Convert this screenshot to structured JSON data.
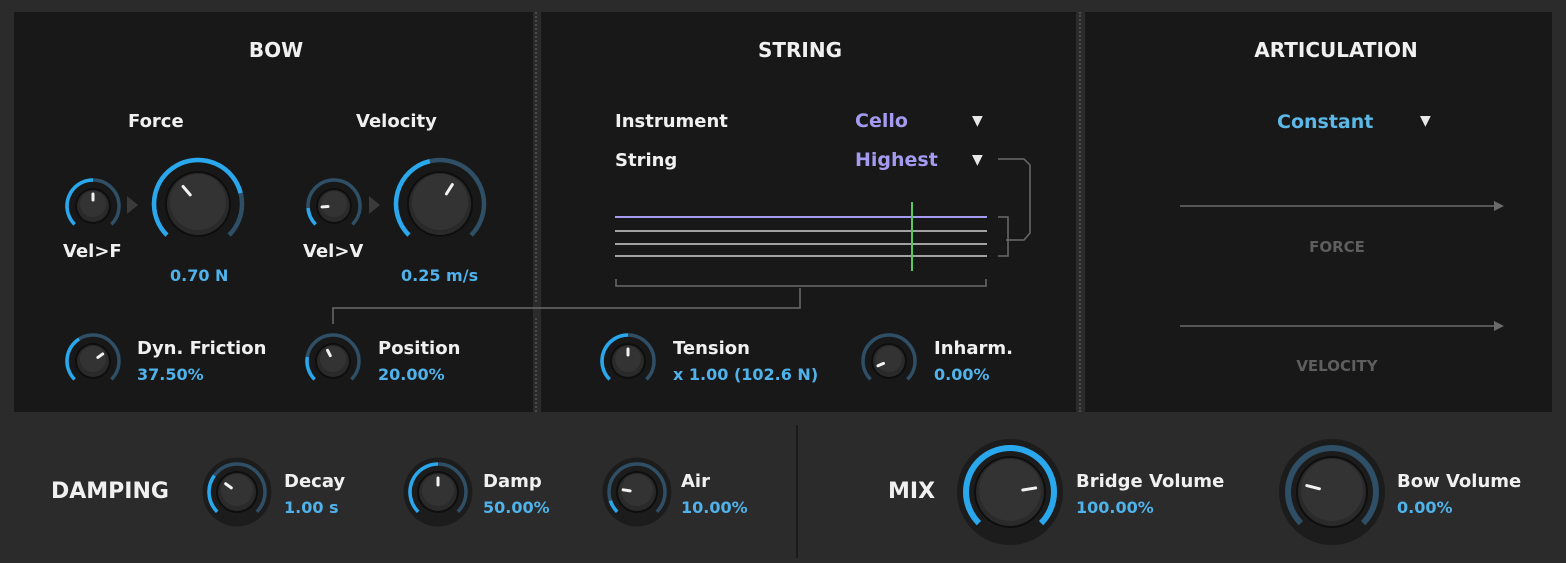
{
  "bow": {
    "title": "BOW",
    "force_label": "Force",
    "velocity_label": "Velocity",
    "vel_f_label": "Vel>F",
    "vel_v_label": "Vel>V",
    "force_value": "0.70 N",
    "velocity_value": "0.25 m/s",
    "dyn_friction_label": "Dyn. Friction",
    "dyn_friction_value": "37.50%",
    "position_label": "Position",
    "position_value": "20.00%"
  },
  "string": {
    "title": "STRING",
    "instrument_label": "Instrument",
    "instrument_value": "Cello",
    "string_label": "String",
    "string_value": "Highest",
    "tension_label": "Tension",
    "tension_value": "x 1.00 (102.6 N)",
    "inharm_label": "Inharm.",
    "inharm_value": "0.00%"
  },
  "articulation": {
    "title": "ARTICULATION",
    "mode_value": "Constant",
    "force_label": "FORCE",
    "velocity_label": "VELOCITY"
  },
  "damping": {
    "title": "DAMPING",
    "decay_label": "Decay",
    "decay_value": "1.00 s",
    "damp_label": "Damp",
    "damp_value": "50.00%",
    "air_label": "Air",
    "air_value": "10.00%"
  },
  "mix": {
    "title": "MIX",
    "bridge_label": "Bridge Volume",
    "bridge_value": "100.00%",
    "bow_label": "Bow Volume",
    "bow_value": "0.00%"
  },
  "icons": {
    "dropdown": "triangle-down-icon",
    "link": "triangle-right-icon"
  },
  "colors": {
    "accent": "#4fb2ea",
    "purple": "#a49bf0",
    "arc_track": "#2f4f66",
    "string_highlight": "#a49bf0",
    "bow_marker": "#5ac85a"
  }
}
